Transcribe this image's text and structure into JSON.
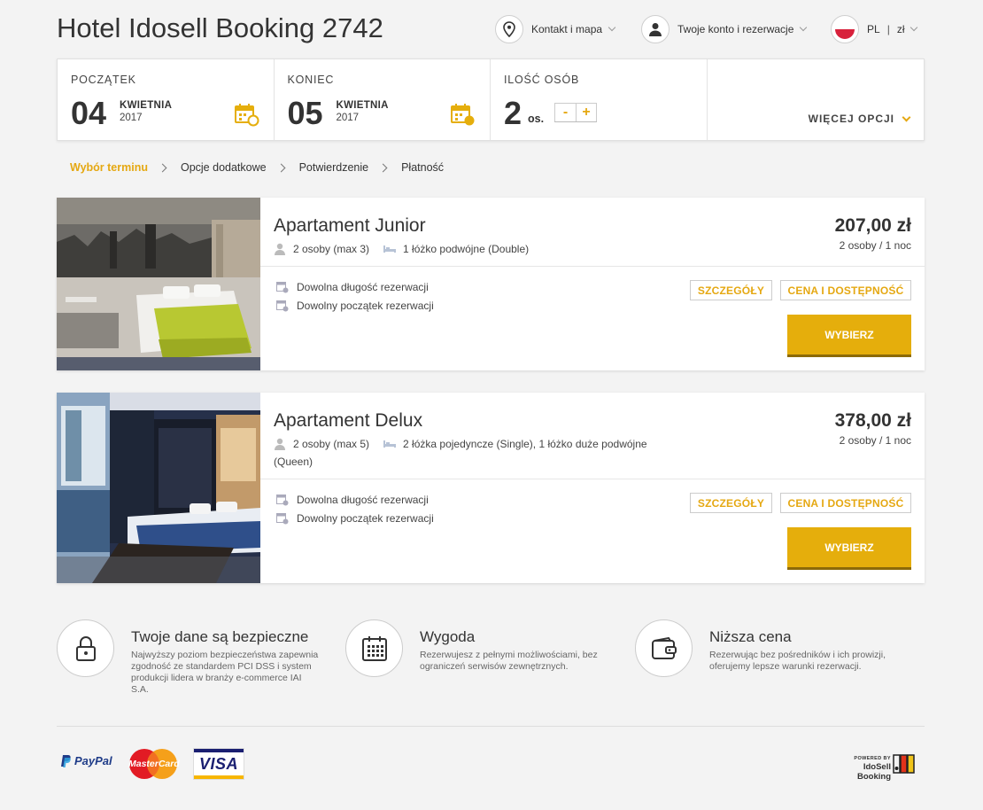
{
  "header": {
    "title": "Hotel Idosell Booking 2742",
    "contact_label": "Kontakt i mapa",
    "account_label": "Twoje konto i rezerwacje",
    "language": "PL",
    "currency": "zł",
    "separator": "|"
  },
  "search": {
    "start": {
      "label": "POCZĄTEK",
      "day": "04",
      "month": "KWIETNIA",
      "year": "2017"
    },
    "end": {
      "label": "KONIEC",
      "day": "05",
      "month": "KWIETNIA",
      "year": "2017"
    },
    "guests": {
      "label": "ILOŚĆ OSÓB",
      "count": "2",
      "unit": "os.",
      "minus": "-",
      "plus": "+"
    },
    "more_options": "WIĘCEJ OPCJI"
  },
  "breadcrumb": [
    "Wybór terminu",
    "Opcje dodatkowe",
    "Potwierdzenie",
    "Płatność"
  ],
  "rooms": [
    {
      "name": "Apartament Junior",
      "guests": "2 osoby (max 3)",
      "beds": "1 łóżko podwójne (Double)",
      "beds_extra": "",
      "price": "207,00 zł",
      "price_note": "2 osoby / 1 noc",
      "features": [
        "Dowolna długość rezerwacji",
        "Dowolny początek rezerwacji"
      ],
      "details_label": "SZCZEGÓŁY",
      "availability_label": "CENA I DOSTĘPNOŚĆ",
      "select_label": "WYBIERZ"
    },
    {
      "name": "Apartament Delux",
      "guests": "2 osoby (max 5)",
      "beds": "2 łóżka pojedyncze (Single), 1 łóżko duże podwójne",
      "beds_extra": "(Queen)",
      "price": "378,00 zł",
      "price_note": "2 osoby / 1 noc",
      "features": [
        "Dowolna długość rezerwacji",
        "Dowolny początek rezerwacji"
      ],
      "details_label": "SZCZEGÓŁY",
      "availability_label": "CENA I DOSTĘPNOŚĆ",
      "select_label": "WYBIERZ"
    }
  ],
  "benefits": [
    {
      "icon": "lock-icon",
      "title": "Twoje dane są bezpieczne",
      "lines": [
        "Najwyższy poziom bezpieczeństwa zapewnia",
        "zgodność ze standardem PCI DSS i system",
        "produkcji lidera w branży e-commerce IAI",
        "S.A."
      ]
    },
    {
      "icon": "calendar-icon",
      "title": "Wygoda",
      "lines": [
        "Rezerwujesz z pełnymi możliwościami, bez",
        "ograniczeń serwisów zewnętrznych."
      ]
    },
    {
      "icon": "wallet-icon",
      "title": "Niższa cena",
      "lines": [
        "Rezerwując bez pośredników i ich prowizji,",
        "oferujemy lepsze warunki rezerwacji."
      ]
    }
  ],
  "footer": {
    "payments": [
      "PayPal",
      "MasterCard",
      "VISA"
    ],
    "powered_by": "POWERED BY",
    "powered_brand": "IdoSell Booking"
  },
  "colors": {
    "accent": "#e5ae0c",
    "accent_dark": "#8c6a08",
    "background": "#f3f3f3"
  }
}
